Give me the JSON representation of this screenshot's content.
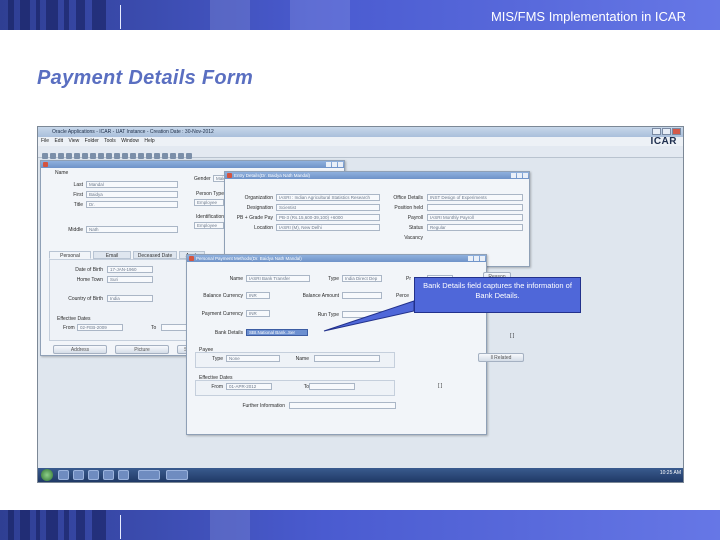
{
  "header": {
    "title": "MIS/FMS Implementation in ICAR"
  },
  "page": {
    "title": "Payment Details Form"
  },
  "callout": {
    "text": "Bank Details field captures the information of Bank Details."
  },
  "screenshot": {
    "window_title": "Oracle Applications - ICAR - UAT Instance - Creation Date : 30-Nov-2012",
    "menu": [
      "File",
      "Edit",
      "View",
      "Folder",
      "Tools",
      "Window",
      "Help"
    ],
    "logo": "ICAR",
    "people_form": {
      "labels": {
        "name": "Name",
        "last": "Last",
        "first": "First",
        "title": "Title",
        "middle": "Middle",
        "gender": "Gender",
        "person_type": "Person Type",
        "identification": "Identification"
      },
      "values": {
        "last": "Mandal",
        "first": "Baidya",
        "title": "Dr.",
        "middle": "Nath",
        "gender": "Male",
        "person_type": "Employee",
        "identification": "Employee"
      },
      "tabs": [
        "Personal",
        "Email",
        "Deceased Date",
        "Apply"
      ],
      "personal": {
        "dob_label": "Date of Birth",
        "dob": "17-JAN-1960",
        "town_label": "Home Town",
        "town": "Suri",
        "country_label": "Country of Birth",
        "country": "India"
      },
      "effective": {
        "heading": "Effective Dates",
        "from_label": "From",
        "from": "02-FEB-2009",
        "to_label": "To"
      },
      "buttons": [
        "Address",
        "Picture",
        "Se"
      ]
    },
    "assignment_form": {
      "title": "Entry Details(Dr. Baidya Nath Mandal)",
      "organization_label": "Organization",
      "organization": "IASRI : Indian Agricultural Statistics Research",
      "designation_label": "Designation",
      "designation": "Scientist",
      "pb_label": "PB + Grade Pay",
      "pb": "PB-3 (Rs.15,600-39,100) +6000",
      "location_label": "Location",
      "location": "IASRI (M), New Delhi",
      "office_label": "Office Details",
      "office": "INST Design of Experiments",
      "position_label": "Position held",
      "payroll_label": "Payroll",
      "payroll": "IASRI Monthly Payroll",
      "status_label": "Status",
      "status": "Regular",
      "vacancy_label": "Vacancy"
    },
    "payment_form": {
      "title": "Personal Payment Methods(Dr. Baidya Nath Mandal)",
      "name_label": "Name",
      "name": "IASRI Bank Transfer",
      "type_label": "Type",
      "type": "India Direct Dep",
      "pr_label": "Pr",
      "reason_label": "Reason",
      "balance_currency_label": "Balance Currency",
      "balance_currency": "INR",
      "balance_amount_label": "Balance Amount",
      "perc_label": "Perce",
      "payment_currency_label": "Payment Currency",
      "payment_currency": "INR",
      "run_type_label": "Run Type",
      "bank_details_label": "Bank Details",
      "bank_details": "SBI.National Bank..Ser",
      "payee_heading": "Payee",
      "payee_type_label": "Type",
      "payee_type": "None",
      "payee_name_label": "Name",
      "effective_heading": "Effective Dates",
      "from_label": "From",
      "from": "01-APR-2012",
      "to_label": "To",
      "further_label": "Further Information",
      "bracket": "[ ]",
      "bracket2": "[ ]",
      "related_button": "ll Related"
    },
    "tray": "10:25 AM"
  }
}
